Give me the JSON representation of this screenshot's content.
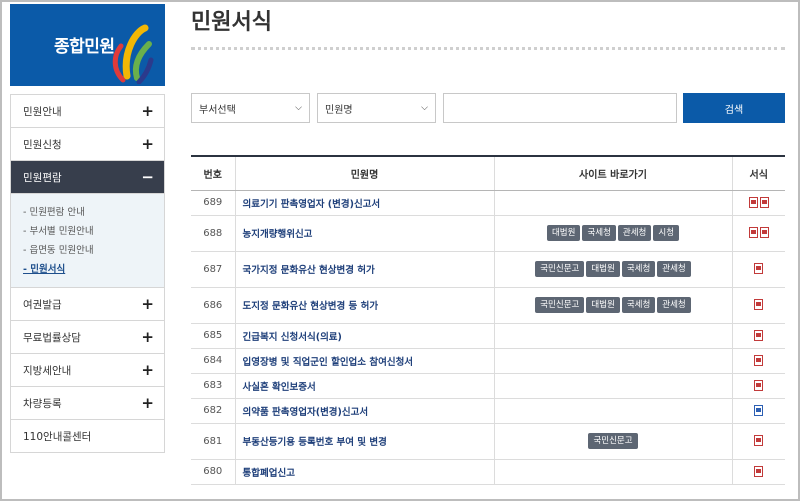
{
  "sidebar": {
    "brand_title": "종합민원",
    "menu": [
      {
        "label": "민원안내",
        "sign": "+"
      },
      {
        "label": "민원신청",
        "sign": "+"
      },
      {
        "label": "민원편람",
        "sign": "−"
      }
    ],
    "submenu": [
      "- 민원편람 안내",
      "- 부서별 민원안내",
      "- 읍면동 민원안내",
      "- 민원서식"
    ],
    "menu_after": [
      {
        "label": "여권발급",
        "sign": "+"
      },
      {
        "label": "무료법률상담",
        "sign": "+"
      },
      {
        "label": "지방세안내",
        "sign": "+"
      },
      {
        "label": "차량등록",
        "sign": "+"
      },
      {
        "label": "110안내콜센터",
        "sign": "⧉"
      }
    ]
  },
  "main": {
    "title": "민원서식",
    "search": {
      "dept_select": "부서선택",
      "name_select": "민원명",
      "button": "검색"
    },
    "table": {
      "headers": [
        "번호",
        "민원명",
        "사이트 바로가기",
        "서식"
      ],
      "rows": [
        {
          "no": "689",
          "name": "의료기기 판촉영업자 (변경)신고서",
          "tags": [],
          "docs": 2
        },
        {
          "no": "688",
          "name": "농지개량행위신고",
          "tags": [
            "대법원",
            "국세청",
            "관세청",
            "시청"
          ],
          "docs": 2
        },
        {
          "no": "687",
          "name": "국가지정 문화유산 현상변경 허가",
          "tags": [
            "국민신문고",
            "대법원",
            "국세청",
            "관세청"
          ],
          "docs": 1
        },
        {
          "no": "686",
          "name": "도지정 문화유산 현상변경 등 허가",
          "tags": [
            "국민신문고",
            "대법원",
            "국세청",
            "관세청"
          ],
          "docs": 1
        },
        {
          "no": "685",
          "name": "긴급복지 신청서식(의료)",
          "tags": [],
          "docs": 1
        },
        {
          "no": "684",
          "name": "입영장병 및 직업군인 할인업소 참여신청서",
          "tags": [],
          "docs": 1
        },
        {
          "no": "683",
          "name": "사실혼 확인보증서",
          "tags": [],
          "docs": 1
        },
        {
          "no": "682",
          "name": "의약품 판촉영업자(변경)신고서",
          "tags": [],
          "docs": 1,
          "doc_color": "blue"
        },
        {
          "no": "681",
          "name": "부동산등기용 등록번호 부여 및 변경",
          "tags": [
            "국민신문고"
          ],
          "docs": 1
        },
        {
          "no": "680",
          "name": "통합폐업신고",
          "tags": [],
          "docs": 1
        }
      ]
    }
  }
}
